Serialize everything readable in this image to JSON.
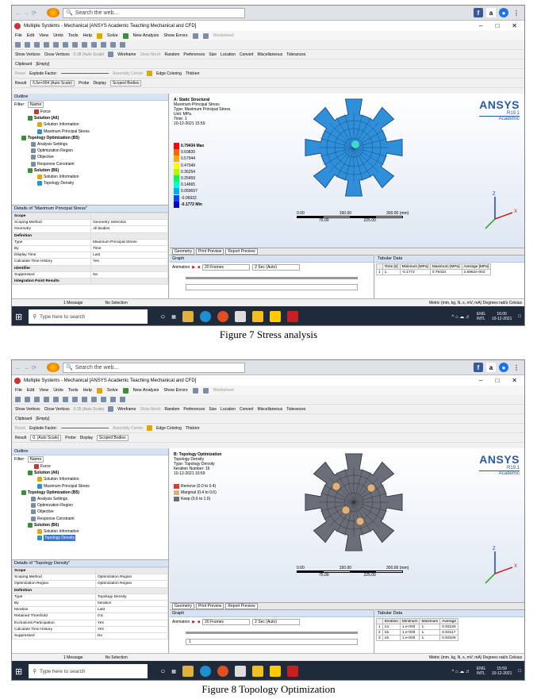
{
  "browser": {
    "search_placeholder": "Search the web..."
  },
  "window": {
    "title": "Multiple Systems - Mechanical [ANSYS Academic Teaching Mechanical and CFD]"
  },
  "menu": [
    "File",
    "Edit",
    "View",
    "Units",
    "Tools",
    "Help"
  ],
  "toolbar": {
    "solve": "Solve",
    "new_analysis": "New Analysis",
    "show_errors": "Show Errors",
    "worksheet": "Worksheet",
    "show_vertices": "Show Vertices",
    "close_vertices": "Close Vertices",
    "wireframe": "Wireframe",
    "show_mesh": "Show Mesh",
    "random": "Random",
    "preferences": "Preferences",
    "size": "Size",
    "location": "Location",
    "convert": "Convert",
    "miscellaneous": "Miscellaneous",
    "tolerances": "Tolerances",
    "clipboard": "Clipboard",
    "empty": "[Empty]",
    "reset": "Reset",
    "explode_factor": "Explode Factor:",
    "assembly_center": "Assembly Center",
    "edge_coloring": "Edge Coloring",
    "thicken": "Thicken",
    "result": "Result",
    "probe": "Probe",
    "display": "Display",
    "scoped_bodies": "Scoped Bodies"
  },
  "outline": {
    "header": "Outline",
    "filter_label": "Filter:",
    "filter_value": "Name",
    "items": [
      "Force",
      "Solution (A6)",
      "Solution Information",
      "Maximum Principal Stress",
      "Topology Optimization (B5)",
      "Analysis Settings",
      "Optimization Region",
      "Objective",
      "Response Constraint",
      "Solution (B6)",
      "Solution Information",
      "Topology Density"
    ]
  },
  "common": {
    "frames": "20 Frames",
    "secs": "2 Sec (Auto)",
    "animation": "Animation",
    "graph": "Graph",
    "tabular": "Tabular Data",
    "geometry_tab": "Geometry",
    "print_tab": "Print Preview",
    "report_tab": "Report Preview",
    "message": "1 Message",
    "no_selection": "No Selection",
    "units": "Metric (mm, kg, N, s, mV, mA)  Degrees  rad/s  Celsius",
    "ansys": "ANSYS",
    "version": "R19.1",
    "academic": "Academic",
    "taskbar_search": "Type here to search",
    "lang": "ENG",
    "lang2": "INTL",
    "scale_0": "0.00",
    "scale_150": "150.00",
    "scale_300": "300.00 (mm)",
    "scale_75": "75.00",
    "scale_225": "225.00",
    "fig1": "Figure 7 Stress analysis",
    "fig2": "Figure 8 Topology Optimization"
  },
  "s1": {
    "scale_text": "0.38 (Auto Scale)",
    "result_value": "6.5e+004 (Auto Scale)",
    "details_header": "Details of \"Maximum Principal Stress\"",
    "details": [
      [
        "Scope",
        ""
      ],
      [
        "Scoping Method",
        "Geometry Selection"
      ],
      [
        "Geometry",
        "All Bodies"
      ],
      [
        "Definition",
        ""
      ],
      [
        "Type",
        "Maximum Principal Stress"
      ],
      [
        "By",
        "Time"
      ],
      [
        "Display Time",
        "Last"
      ],
      [
        "Calculate Time History",
        "Yes"
      ],
      [
        "Identifier",
        ""
      ],
      [
        "Suppressed",
        "No"
      ],
      [
        "Integration Point Results",
        ""
      ]
    ],
    "info": [
      "A: Static Structural",
      "Maximum Principal Stress",
      "Type: Maximum Principal Stress",
      "Unit: MPa",
      "Time: 1",
      "10-12-2021 15:59"
    ],
    "legend": [
      "0.79434 Max",
      "0.69839",
      "0.57944",
      "0.47049",
      "0.36254",
      "0.25459",
      "0.14665",
      "0.059697",
      "-0.06932",
      "-0.1772 Min"
    ],
    "tab_headers": [
      "",
      "Time [s]",
      "Minimum [MPa]",
      "Maximum [MPa]",
      "Average [MPa]"
    ],
    "tab_rows": [
      [
        "1",
        "1.",
        "-0.1772",
        "0.79434",
        "2.6982e-002"
      ]
    ],
    "clock": "16:00",
    "date": "10-12-2021"
  },
  "s2": {
    "scale_text": "0.35 (Auto Scale)",
    "result_value": "0. (Auto Scale)",
    "details_header": "Details of \"Topology Density\"",
    "details": [
      [
        "Scope",
        ""
      ],
      [
        "Scoping Method",
        "Optimization Region"
      ],
      [
        "Optimization Region",
        "Optimization Region"
      ],
      [
        "Definition",
        ""
      ],
      [
        "Type",
        "Topology Density"
      ],
      [
        "By",
        "Iteration"
      ],
      [
        "Iteration",
        "Last"
      ],
      [
        "Retained Threshold",
        "0.5"
      ],
      [
        "Exclusions Participation",
        "Yes"
      ],
      [
        "Calculate Time History",
        "Yes"
      ],
      [
        "Suppressed",
        "No"
      ]
    ],
    "info": [
      "B: Topology Optimization",
      "Topology Density",
      "Type: Topology Density",
      "Iteration Number: 16",
      "10-12-2021 15:59"
    ],
    "legend": [
      "Remove (0.0 to 0.4)",
      "Marginal (0.4 to 0.6)",
      "Keep (0.6 to 1.0)"
    ],
    "tab_headers": [
      "",
      "Iteration",
      "Minimum",
      "Maximum",
      "Average"
    ],
    "tab_rows": [
      [
        "1",
        "14.",
        "1.e-003",
        "1.",
        "0.93128"
      ],
      [
        "2",
        "15.",
        "1.e-003",
        "1.",
        "0.93117"
      ],
      [
        "3",
        "16.",
        "1.e-003",
        "1.",
        "0.93106"
      ]
    ],
    "graph_tick": "1",
    "clock": "15:59",
    "date": "10-12-2021"
  },
  "colors": {
    "stress_scale": [
      "#ff0000",
      "#ff6600",
      "#ffaa00",
      "#ffff00",
      "#aaff00",
      "#00ff55",
      "#00ffdd",
      "#00aaff",
      "#0044ff",
      "#0000cc"
    ],
    "topo_scale": [
      "#e03a2a",
      "#e0b080",
      "#6e6e6e"
    ],
    "mesh_blue": "#2f8fd8",
    "mesh_gray": "#6a6e78"
  }
}
